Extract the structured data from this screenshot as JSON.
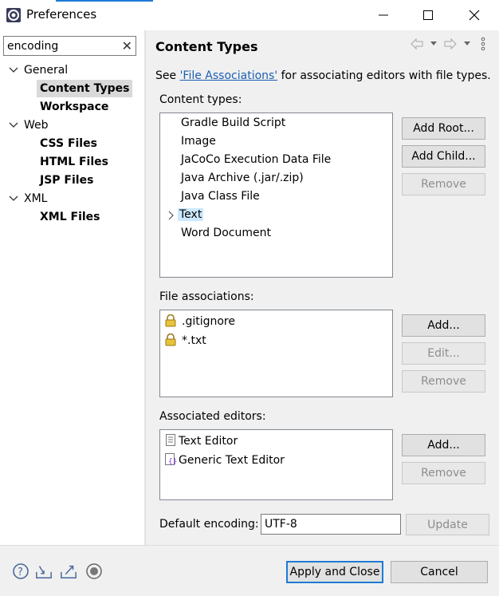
{
  "window": {
    "title": "Preferences",
    "accent_color": "#1e7bd4"
  },
  "filter": {
    "value": "encoding",
    "clear_icon": "close-icon"
  },
  "tree": {
    "general": "General",
    "content_types": "Content Types",
    "workspace": "Workspace",
    "web": "Web",
    "css_files": "CSS Files",
    "html_files": "HTML Files",
    "jsp_files": "JSP Files",
    "xml": "XML",
    "xml_files": "XML Files"
  },
  "page": {
    "title": "Content Types",
    "see_prefix": "See ",
    "see_link": "'File Associations'",
    "see_suffix": " for associating editors with file types.",
    "content_types_label": "Content types:",
    "file_assoc_label": "File associations:",
    "assoc_editors_label": "Associated editors:",
    "default_encoding_label": "Default encoding:",
    "default_encoding_value": "UTF-8"
  },
  "content_types": [
    "Gradle Build Script",
    "Image",
    "JaCoCo Execution Data File",
    "Java Archive (.jar/.zip)",
    "Java Class File",
    "Text",
    "Word Document"
  ],
  "file_associations": [
    ".gitignore",
    "*.txt"
  ],
  "associated_editors": [
    "Text Editor",
    "Generic Text Editor"
  ],
  "buttons": {
    "add_root": "Add Root...",
    "add_child": "Add Child...",
    "remove": "Remove",
    "add": "Add...",
    "edit": "Edit...",
    "update": "Update",
    "apply_close": "Apply and Close",
    "cancel": "Cancel"
  }
}
